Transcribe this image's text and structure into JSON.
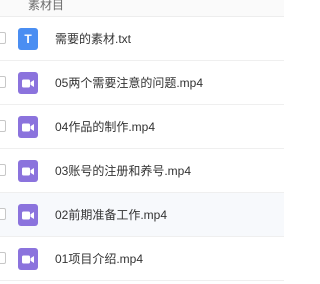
{
  "header": {
    "folder_title": "素材目"
  },
  "files": [
    {
      "name": "需要的素材.txt",
      "type": "txt",
      "icon": "text-file-icon",
      "icon_letter": "T"
    },
    {
      "name": "05两个需要注意的问题.mp4",
      "type": "video",
      "icon": "video-file-icon"
    },
    {
      "name": "04作品的制作.mp4",
      "type": "video",
      "icon": "video-file-icon"
    },
    {
      "name": "03账号的注册和养号.mp4",
      "type": "video",
      "icon": "video-file-icon"
    },
    {
      "name": "02前期准备工作.mp4",
      "type": "video",
      "icon": "video-file-icon"
    },
    {
      "name": "01项目介绍.mp4",
      "type": "video",
      "icon": "video-file-icon"
    }
  ],
  "colors": {
    "txt_icon": "#4a8ef2",
    "video_icon": "#8b73dd",
    "highlight_row": "#f7f9fc"
  }
}
